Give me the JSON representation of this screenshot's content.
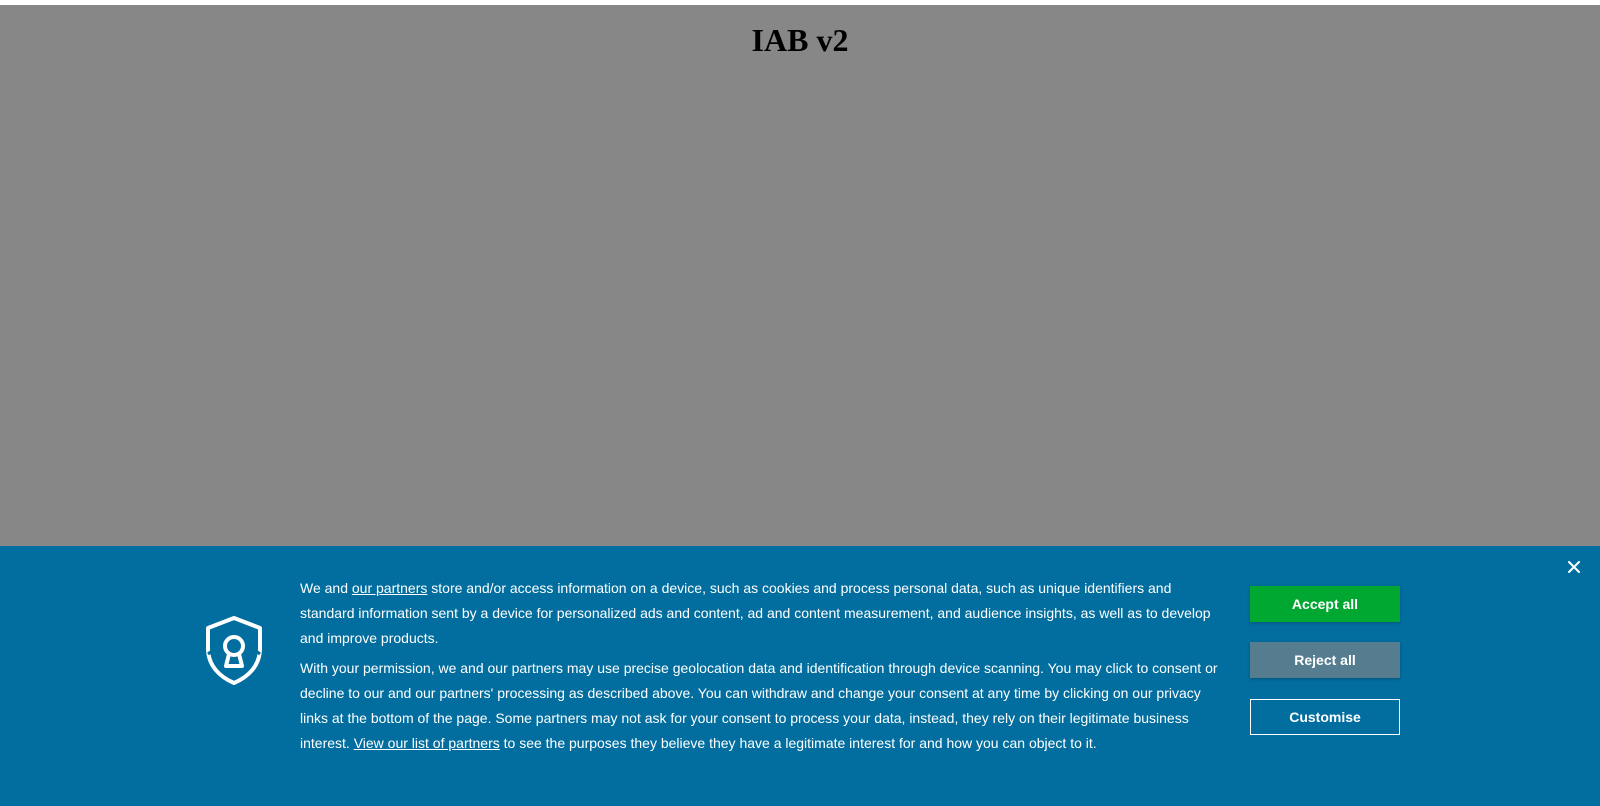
{
  "page": {
    "title": "IAB v2"
  },
  "consent": {
    "close_symbol": "×",
    "icon": "shield-keyhole-icon",
    "p1_before": "We and ",
    "p1_link": "our partners",
    "p1_after": " store and/or access information on a device, such as cookies and process personal data, such as unique identifiers and standard information sent by a device for personalized ads and content, ad and content measurement, and audience insights, as well as to develop and improve products.",
    "p2_before": "With your permission, we and our partners may use precise geolocation data and identification through device scanning. You may click to consent or decline to our and our partners' processing as described above. You can withdraw and change your consent at any time by clicking on our privacy links at the bottom of the page. Some partners may not ask for your consent to process your data, instead, they rely on their legitimate business interest. ",
    "p2_link": "View our list of partners",
    "p2_after": " to see the purposes they believe they have a legitimate interest for and how you can object to it.",
    "buttons": {
      "accept": "Accept all",
      "reject": "Reject all",
      "customise": "Customise"
    }
  },
  "colors": {
    "banner_bg": "#016e9f",
    "accept_bg": "#00a832",
    "reject_bg": "#567d8f",
    "overlay": "#888888"
  }
}
